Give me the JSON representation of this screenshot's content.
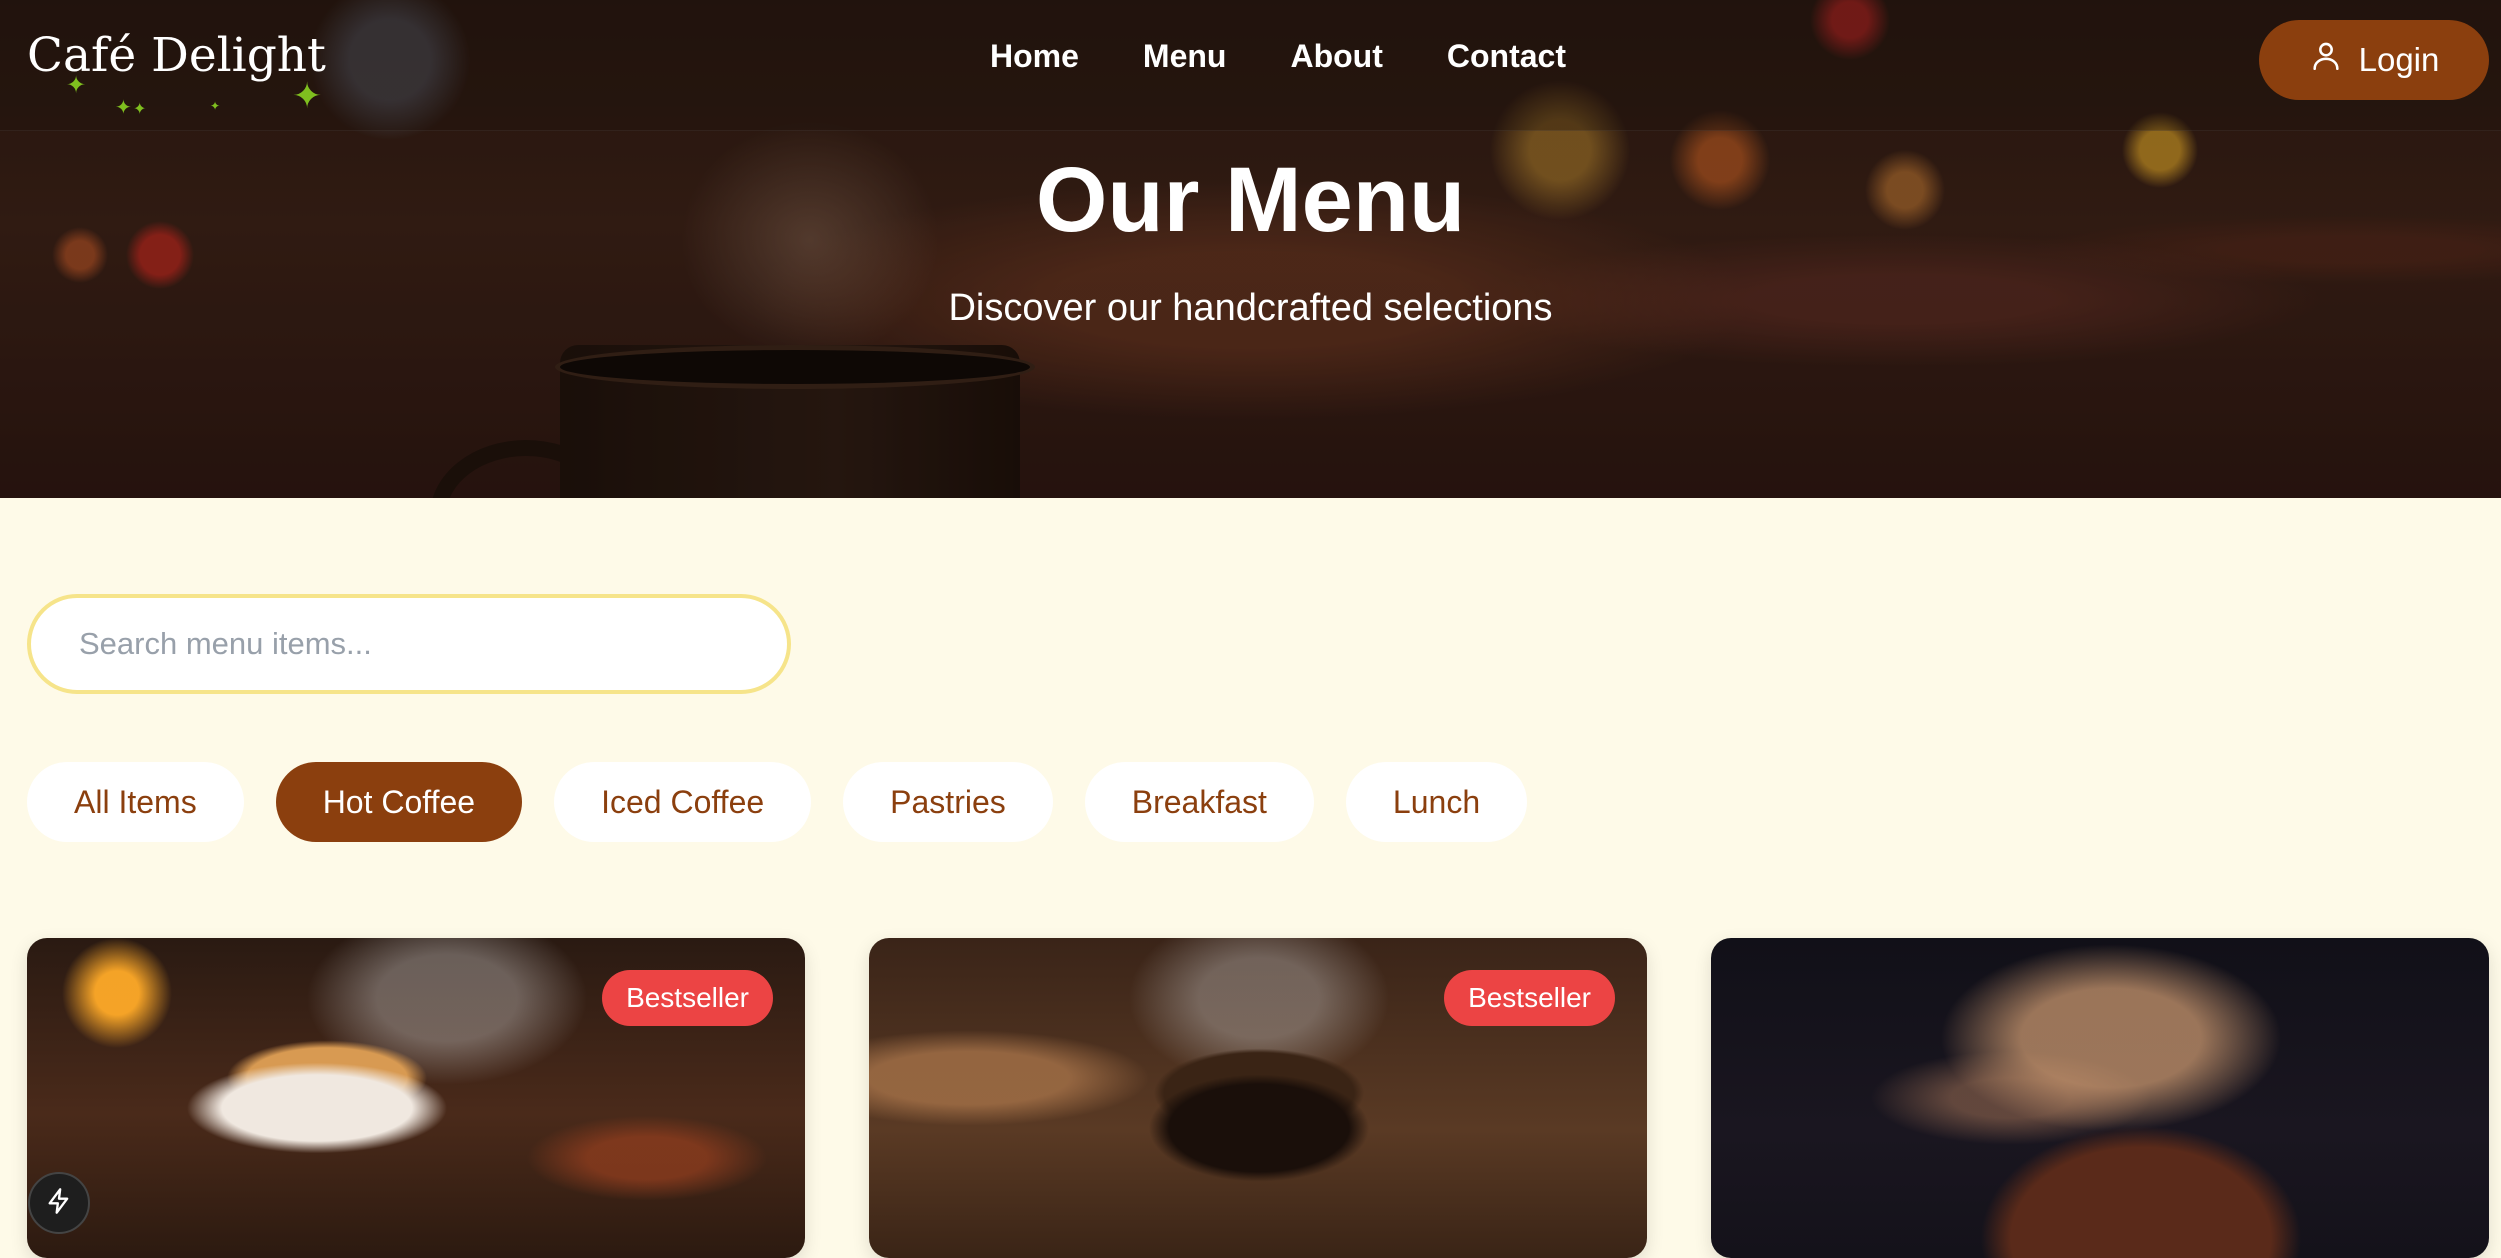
{
  "header": {
    "logo": "Café Delight",
    "nav": [
      "Home",
      "Menu",
      "About",
      "Contact"
    ],
    "login_label": "Login"
  },
  "hero": {
    "title": "Our Menu",
    "subtitle": "Discover our handcrafted selections"
  },
  "search": {
    "placeholder": "Search menu items...",
    "value": ""
  },
  "filters": {
    "items": [
      "All Items",
      "Hot Coffee",
      "Iced Coffee",
      "Pastries",
      "Breakfast",
      "Lunch"
    ],
    "active": "Hot Coffee"
  },
  "cards": [
    {
      "badge": "Bestseller"
    },
    {
      "badge": "Bestseller"
    },
    {
      "badge": ""
    }
  ],
  "colors": {
    "brand": "#8b3f0e",
    "page_background": "#fefae8",
    "badge": "#ec4444",
    "search_border": "#f6e48a"
  },
  "icons": {
    "login": "user-icon",
    "floating_button": "lightning-bolt-icon",
    "logo_decoration": "sparkle-icon"
  }
}
